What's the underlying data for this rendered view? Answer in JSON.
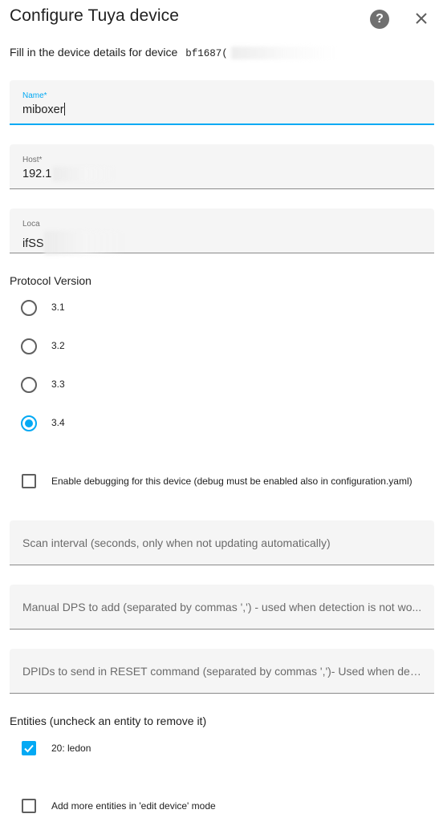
{
  "dialog": {
    "title": "Configure Tuya device",
    "help_icon": "help-circle-icon",
    "close_icon": "close-icon",
    "description": "Fill in the device details for device",
    "device_id_prefix": "bf1687("
  },
  "fields": {
    "name": {
      "label": "Name*",
      "value": "miboxer"
    },
    "host": {
      "label": "Host*",
      "value": "192.1"
    },
    "local_key": {
      "label": "Loca",
      "value": "ifSS"
    },
    "scan_interval": {
      "placeholder": "Scan interval (seconds, only when not updating automatically)"
    },
    "manual_dps": {
      "placeholder": "Manual DPS to add (separated by commas ',') - used when detection is not wo..."
    },
    "reset_dpids": {
      "placeholder": "DPIDs to send in RESET command (separated by commas ',')- Used when devi..."
    }
  },
  "protocol": {
    "label": "Protocol Version",
    "options": [
      {
        "label": "3.1",
        "checked": false
      },
      {
        "label": "3.2",
        "checked": false
      },
      {
        "label": "3.3",
        "checked": false
      },
      {
        "label": "3.4",
        "checked": true
      }
    ]
  },
  "debug": {
    "label": "Enable debugging for this device (debug must be enabled also in configuration.yaml)",
    "checked": false
  },
  "entities": {
    "label": "Entities (uncheck an entity to remove it)",
    "items": [
      {
        "label": "20: ledon",
        "checked": true
      }
    ]
  },
  "add_more": {
    "label": "Add more entities in 'edit device' mode",
    "checked": false
  },
  "colors": {
    "accent": "#03a9f4",
    "field_bg": "#f5f5f5",
    "text": "#212121"
  }
}
